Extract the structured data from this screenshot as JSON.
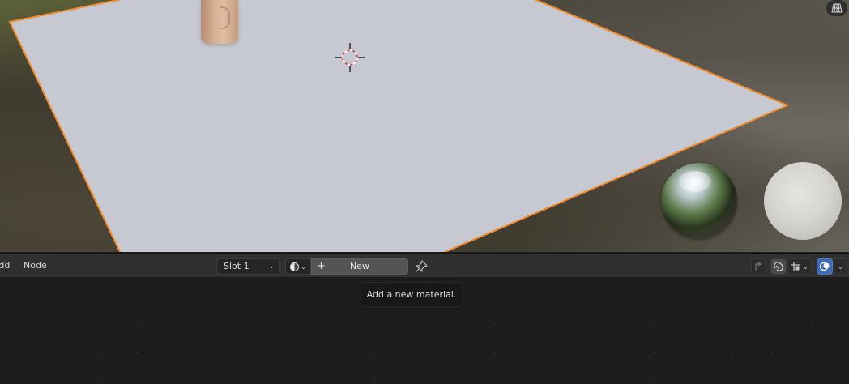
{
  "header": {
    "menu": [
      "Add",
      "Node"
    ],
    "slot_select": "Slot 1",
    "new_button_label": "New"
  },
  "tooltip": {
    "text": "Add a new material."
  },
  "icons": {
    "viewport": [
      "3d-cursor-icon",
      "grid-toggle-icon"
    ],
    "header": [
      "material-browse-icon",
      "plus-icon",
      "pin-icon",
      "parent-node-tree-icon",
      "snap-icon",
      "snap-mode-icon",
      "overlay-icon"
    ]
  },
  "colors": {
    "selection_outline": "#f28a2a",
    "plane_fill": "#c6c9d1",
    "header_bg": "#303030",
    "canvas_bg": "#1d1d1d",
    "overlay_active": "#3f6db5"
  }
}
